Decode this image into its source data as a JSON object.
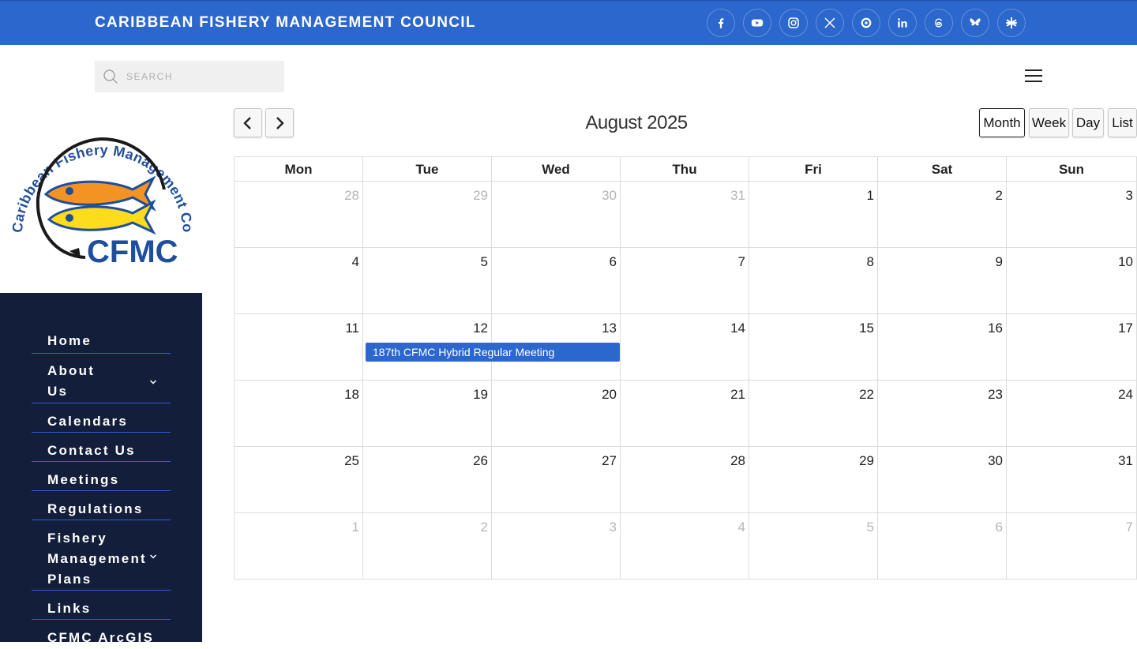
{
  "header": {
    "title": "CARIBBEAN FISHERY MANAGEMENT COUNCIL",
    "socials": [
      "facebook-icon",
      "youtube-icon",
      "instagram-icon",
      "x-icon",
      "circle-icon",
      "linkedin-icon",
      "threads-icon",
      "bluesky-icon",
      "linktree-icon"
    ]
  },
  "search": {
    "placeholder": "SEARCH"
  },
  "logo": {
    "arc_text": "Caribbean Fishery Management Council",
    "wordmark": "CFMC"
  },
  "sidebar": {
    "items": [
      {
        "label": "Home"
      },
      {
        "label": "About\nUs"
      },
      {
        "label": "Calendars"
      },
      {
        "label": "Contact Us"
      },
      {
        "label": "Meetings"
      },
      {
        "label": "Regulations"
      },
      {
        "label": "Fishery\nManagement\nPlans"
      },
      {
        "label": "Links"
      },
      {
        "label": "CFMC ArcGIS"
      }
    ]
  },
  "calendar": {
    "title": "August 2025",
    "views": [
      "Month",
      "Week",
      "Day",
      "List"
    ],
    "active_view": "Month",
    "weekdays": [
      "Mon",
      "Tue",
      "Wed",
      "Thu",
      "Fri",
      "Sat",
      "Sun"
    ],
    "weeks": [
      [
        "28",
        "29",
        "30",
        "31",
        "1",
        "2",
        "3"
      ],
      [
        "4",
        "5",
        "6",
        "7",
        "8",
        "9",
        "10"
      ],
      [
        "11",
        "12",
        "13",
        "14",
        "15",
        "16",
        "17"
      ],
      [
        "18",
        "19",
        "20",
        "21",
        "22",
        "23",
        "24"
      ],
      [
        "25",
        "26",
        "27",
        "28",
        "29",
        "30",
        "31"
      ],
      [
        "1",
        "2",
        "3",
        "4",
        "5",
        "6",
        "7"
      ]
    ],
    "events": [
      {
        "title": "187th CFMC Hybrid Regular Meeting",
        "start": "12",
        "end": "13"
      }
    ]
  },
  "colors": {
    "brand": "#2b67cc",
    "sidebar": "#131e3b",
    "logo_blue": "#1f4e9c",
    "fish_orange": "#f39324",
    "fish_yellow": "#fddb1d"
  }
}
